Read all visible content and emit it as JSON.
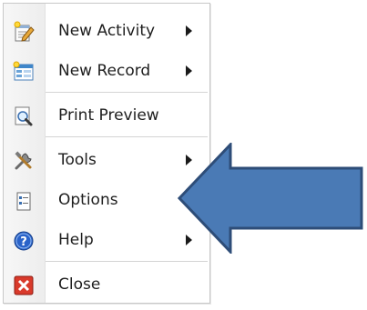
{
  "menu": {
    "items": [
      {
        "label": "New Activity",
        "icon": "new-activity-icon",
        "submenu": true
      },
      {
        "label": "New Record",
        "icon": "new-record-icon",
        "submenu": true
      },
      {
        "label": "Print Preview",
        "icon": "print-preview-icon",
        "submenu": false
      },
      {
        "label": "Tools",
        "icon": "tools-icon",
        "submenu": true
      },
      {
        "label": "Options",
        "icon": "options-icon",
        "submenu": false
      },
      {
        "label": "Help",
        "icon": "help-icon",
        "submenu": true
      },
      {
        "label": "Close",
        "icon": "close-icon",
        "submenu": false
      }
    ]
  },
  "colors": {
    "arrow_fill": "#4a7ab5",
    "arrow_stroke": "#2e4d78",
    "help_blue": "#2a63c9",
    "close_red": "#d93a2b"
  }
}
